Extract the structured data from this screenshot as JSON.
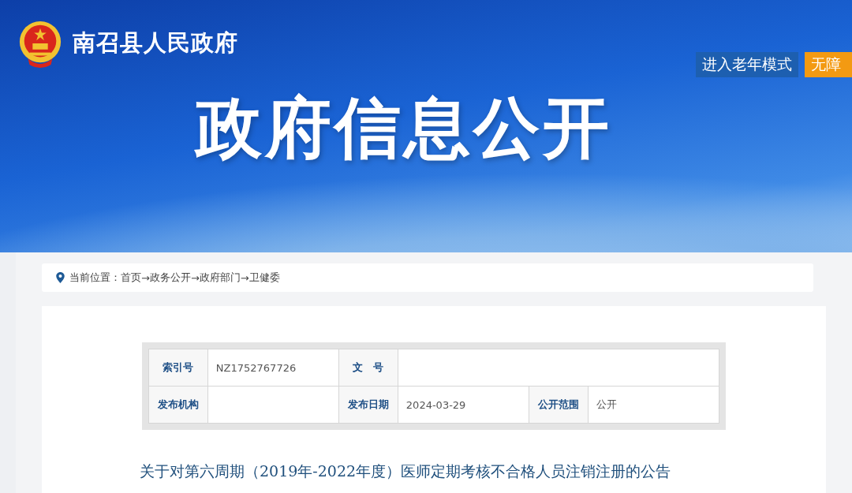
{
  "header": {
    "site_name": "南召县人民政府",
    "buttons": [
      {
        "label": "进入老年模式",
        "kind": "elder"
      },
      {
        "label": "无障",
        "kind": "accessible"
      }
    ],
    "banner_title": "政府信息公开"
  },
  "breadcrumb": {
    "prefix": "当前位置：",
    "separator": "→",
    "items": [
      "首页",
      "政务公开",
      "政府部门",
      "卫健委"
    ]
  },
  "info_table": {
    "rows": [
      [
        {
          "label": "索引号",
          "value": "NZ1752767726"
        },
        {
          "label": "文　号",
          "span": true
        }
      ],
      [
        {
          "label": "发布机构"
        },
        {
          "label": "发布日期",
          "value": "2024-03-29"
        },
        {
          "label": "公开范围",
          "value": "公开"
        }
      ]
    ]
  },
  "article": {
    "title": "关于对第六周期（2019年-2022年度）医师定期考核不合格人员注销注册的公告"
  }
}
